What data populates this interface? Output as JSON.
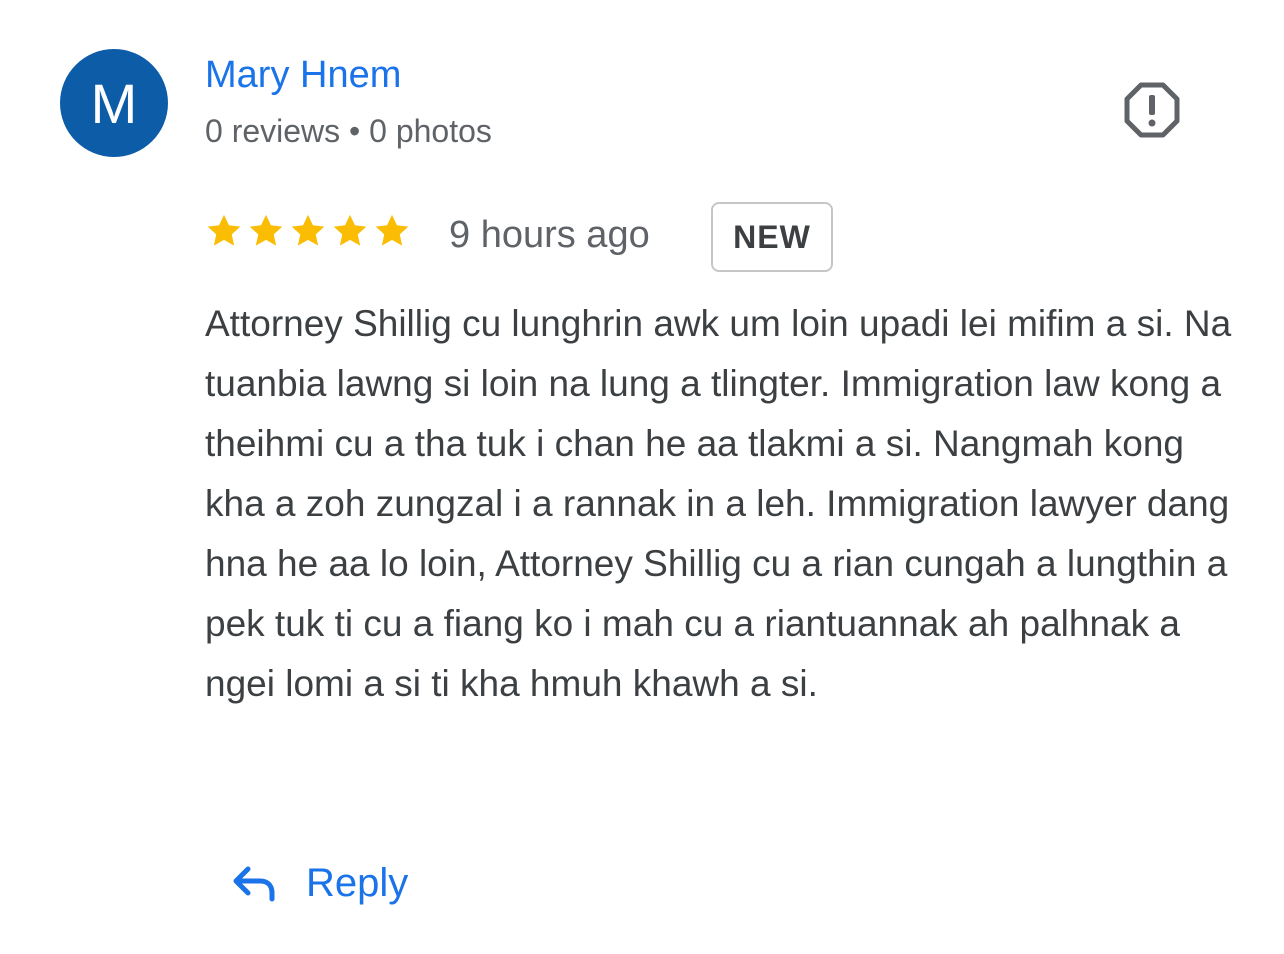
{
  "author": {
    "initial": "M",
    "name": "Mary Hnem",
    "meta": "0 reviews • 0 photos",
    "avatar_color": "#0d5ca8",
    "name_color": "#1a73e8"
  },
  "report": {
    "icon": "report-icon"
  },
  "review": {
    "rating": 5,
    "rating_max": 5,
    "star_color": "#fbbc04",
    "time_ago": "9 hours ago",
    "badge": "NEW",
    "text": "Attorney Shillig cu lunghrin awk um loin upadi lei mifim a si. Na tuanbia lawng si loin na lung a tlingter. Immigration law kong a theihmi cu a tha tuk i chan he aa tlakmi a si. Nangmah kong kha a zoh zungzal i a rannak in a leh. Immigration lawyer dang hna he aa lo loin, Attorney Shillig cu a rian cungah a lungthin a pek tuk ti cu a fiang ko i mah cu a riantuannak ah palhnak a ngei lomi a si ti kha hmuh khawh a si."
  },
  "actions": {
    "reply_label": "Reply",
    "reply_icon": "reply-arrow-icon",
    "accent_color": "#1a73e8"
  }
}
